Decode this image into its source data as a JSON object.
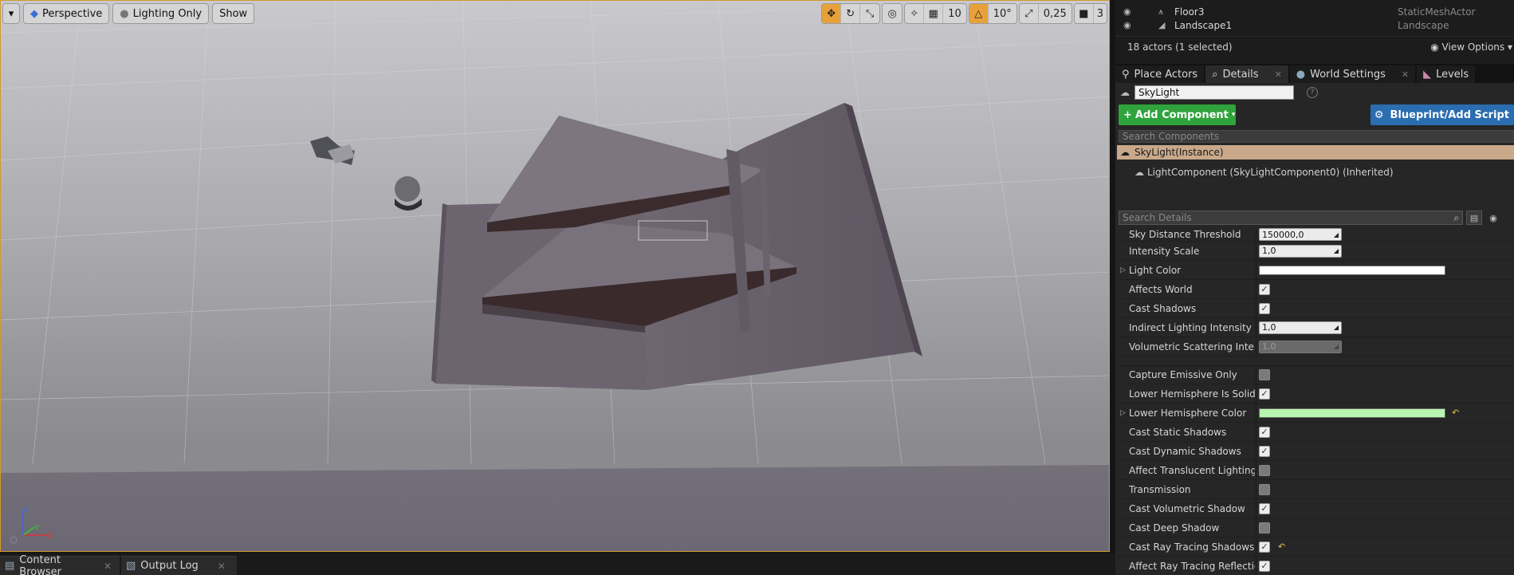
{
  "viewport": {
    "left_toolbar": {
      "menu_icon": "chevron-down-icon",
      "perspective_label": "Perspective",
      "view_mode_label": "Lighting Only",
      "show_label": "Show"
    },
    "right_toolbar": {
      "grid_snap_value": "10",
      "rotation_snap_value": "10°",
      "scale_snap_value": "0,25",
      "camera_speed_value": "3"
    },
    "axis_labels": {
      "x": "X",
      "y": "Y",
      "z": "Z"
    }
  },
  "bottom_tabs": [
    {
      "label": "Content Browser",
      "icon": "content-browser-icon"
    },
    {
      "label": "Output Log",
      "icon": "output-log-icon"
    }
  ],
  "outliner": {
    "rows": [
      {
        "name": "Floor3",
        "type": "StaticMeshActor"
      },
      {
        "name": "Landscape1",
        "type": "Landscape"
      }
    ],
    "count_text": "18 actors (1 selected)",
    "view_options_label": "View Options"
  },
  "panel_tabs": [
    {
      "label": "Place Actors"
    },
    {
      "label": "Details"
    },
    {
      "label": "World Settings"
    },
    {
      "label": "Levels"
    }
  ],
  "details": {
    "actor_name": "SkyLight",
    "add_component_label": "Add Component",
    "blueprint_label": "Blueprint/Add Script",
    "search_components_placeholder": "Search Components",
    "selected_component": "SkyLight(Instance)",
    "child_component": "LightComponent (SkyLightComponent0) (Inherited)",
    "search_details_placeholder": "Search Details",
    "properties": {
      "sky_distance_threshold": {
        "label": "Sky Distance Threshold",
        "value": "150000,0"
      },
      "intensity_scale": {
        "label": "Intensity Scale",
        "value": "1,0"
      },
      "light_color": {
        "label": "Light Color",
        "color": "#ffffff"
      },
      "affects_world": {
        "label": "Affects World",
        "checked": true
      },
      "cast_shadows": {
        "label": "Cast Shadows",
        "checked": true
      },
      "indirect_lighting_intensity": {
        "label": "Indirect Lighting Intensity",
        "value": "1,0"
      },
      "volumetric_scattering_intensity": {
        "label": "Volumetric Scattering Intensity",
        "value": "1,0"
      },
      "capture_emissive_only": {
        "label": "Capture Emissive Only",
        "checked": false
      },
      "lower_hemisphere_is_solid_color": {
        "label": "Lower Hemisphere Is Solid Color",
        "checked": true
      },
      "lower_hemisphere_color": {
        "label": "Lower Hemisphere Color",
        "color": "#b8f5b0"
      },
      "cast_static_shadows": {
        "label": "Cast Static Shadows",
        "checked": true
      },
      "cast_dynamic_shadows": {
        "label": "Cast Dynamic Shadows",
        "checked": true
      },
      "affect_translucent_lighting": {
        "label": "Affect Translucent Lighting",
        "checked": false
      },
      "transmission": {
        "label": "Transmission",
        "checked": false
      },
      "cast_volumetric_shadow": {
        "label": "Cast Volumetric Shadow",
        "checked": true
      },
      "cast_deep_shadow": {
        "label": "Cast Deep Shadow",
        "checked": false
      },
      "cast_ray_tracing_shadows": {
        "label": "Cast Ray Tracing Shadows",
        "checked": true
      },
      "affect_ray_tracing_reflections": {
        "label": "Affect Ray Tracing Reflections",
        "checked": true
      }
    }
  },
  "colors": {
    "accent_orange": "#e8a13a",
    "add_component_green": "#2fa33c",
    "blueprint_blue": "#2a6db0",
    "selected_component_tan": "#c9a98a"
  }
}
